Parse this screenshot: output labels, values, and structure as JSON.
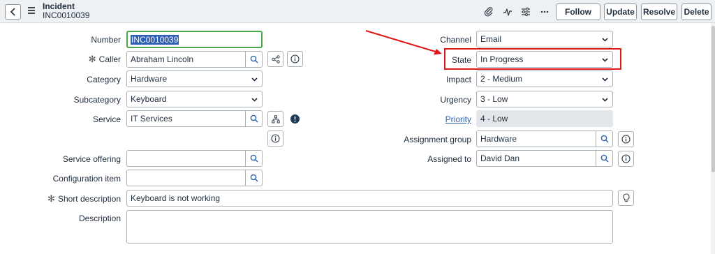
{
  "header": {
    "record_type": "Incident",
    "record_number": "INC0010039",
    "icons": [
      "attachment-icon",
      "activity-icon",
      "settings-icon",
      "more-icon"
    ],
    "buttons": {
      "follow": "Follow",
      "update": "Update",
      "resolve": "Resolve",
      "delete": "Delete"
    }
  },
  "form": {
    "number": {
      "label": "Number",
      "value": "INC0010039"
    },
    "caller": {
      "label": "Caller",
      "value": "Abraham Lincoln",
      "required": true
    },
    "category": {
      "label": "Category",
      "value": "Hardware"
    },
    "subcategory": {
      "label": "Subcategory",
      "value": "Keyboard"
    },
    "service": {
      "label": "Service",
      "value": "IT Services"
    },
    "service_offering": {
      "label": "Service offering",
      "value": ""
    },
    "configuration_item": {
      "label": "Configuration item",
      "value": ""
    },
    "short_description": {
      "label": "Short description",
      "value": "Keyboard is not working",
      "required": true
    },
    "description": {
      "label": "Description",
      "value": ""
    },
    "channel": {
      "label": "Channel",
      "value": "Email"
    },
    "state": {
      "label": "State",
      "value": "In Progress"
    },
    "impact": {
      "label": "Impact",
      "value": "2 - Medium"
    },
    "urgency": {
      "label": "Urgency",
      "value": "3 - Low"
    },
    "priority": {
      "label": "Priority",
      "value": "4 - Low"
    },
    "assignment_group": {
      "label": "Assignment group",
      "value": "Hardware"
    },
    "assigned_to": {
      "label": "Assigned to",
      "value": "David Dan"
    }
  },
  "annotation": {
    "highlight_color": "#e01818",
    "target": "state"
  },
  "colors": {
    "header_bg": "#eef1f4",
    "focus_border": "#4aa84a",
    "selection_bg": "#2f5fb4",
    "link": "#2d63a8"
  }
}
